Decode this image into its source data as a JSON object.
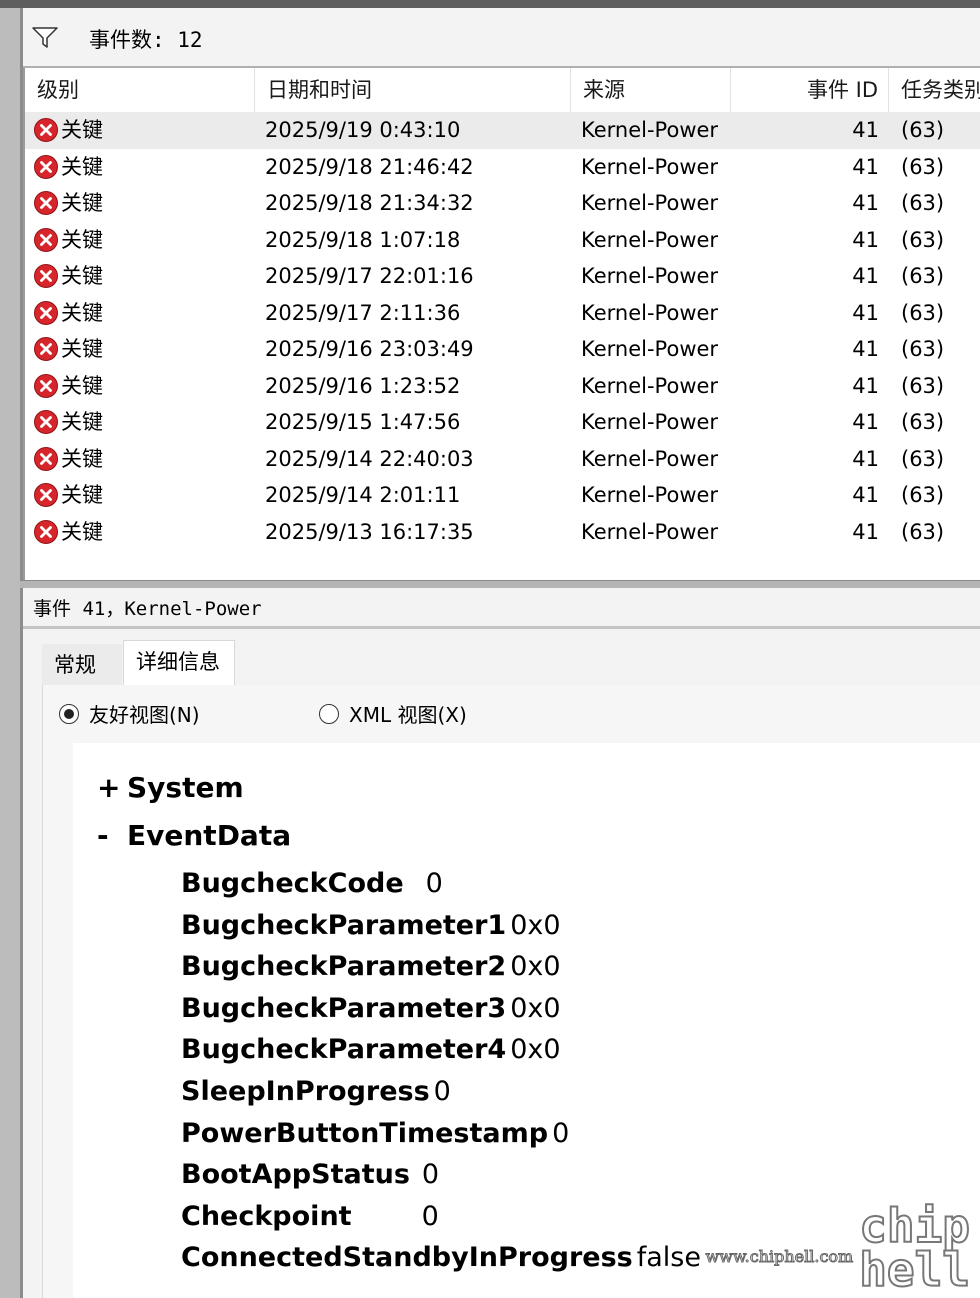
{
  "filter": {
    "label": "事件数: 12"
  },
  "columns": {
    "level": "级别",
    "datetime": "日期和时间",
    "source": "来源",
    "event_id": "事件 ID",
    "task": "任务类别"
  },
  "events": [
    {
      "level": "关键",
      "datetime": "2025/9/19 0:43:10",
      "source": "Kernel-Power",
      "event_id": "41",
      "task": "(63)"
    },
    {
      "level": "关键",
      "datetime": "2025/9/18 21:46:42",
      "source": "Kernel-Power",
      "event_id": "41",
      "task": "(63)"
    },
    {
      "level": "关键",
      "datetime": "2025/9/18 21:34:32",
      "source": "Kernel-Power",
      "event_id": "41",
      "task": "(63)"
    },
    {
      "level": "关键",
      "datetime": "2025/9/18 1:07:18",
      "source": "Kernel-Power",
      "event_id": "41",
      "task": "(63)"
    },
    {
      "level": "关键",
      "datetime": "2025/9/17 22:01:16",
      "source": "Kernel-Power",
      "event_id": "41",
      "task": "(63)"
    },
    {
      "level": "关键",
      "datetime": "2025/9/17 2:11:36",
      "source": "Kernel-Power",
      "event_id": "41",
      "task": "(63)"
    },
    {
      "level": "关键",
      "datetime": "2025/9/16 23:03:49",
      "source": "Kernel-Power",
      "event_id": "41",
      "task": "(63)"
    },
    {
      "level": "关键",
      "datetime": "2025/9/16 1:23:52",
      "source": "Kernel-Power",
      "event_id": "41",
      "task": "(63)"
    },
    {
      "level": "关键",
      "datetime": "2025/9/15 1:47:56",
      "source": "Kernel-Power",
      "event_id": "41",
      "task": "(63)"
    },
    {
      "level": "关键",
      "datetime": "2025/9/14 22:40:03",
      "source": "Kernel-Power",
      "event_id": "41",
      "task": "(63)"
    },
    {
      "level": "关键",
      "datetime": "2025/9/14 2:01:11",
      "source": "Kernel-Power",
      "event_id": "41",
      "task": "(63)"
    },
    {
      "level": "关键",
      "datetime": "2025/9/13 16:17:35",
      "source": "Kernel-Power",
      "event_id": "41",
      "task": "(63)"
    }
  ],
  "detail": {
    "title": "事件 41，Kernel-Power",
    "tabs": {
      "general": "常规",
      "details": "详细信息"
    },
    "views": {
      "friendly": "友好视图(N)",
      "xml": "XML 视图(X)"
    },
    "tree": {
      "system": {
        "toggle": "+",
        "label": "System"
      },
      "eventdata": {
        "toggle": "-",
        "label": "EventData",
        "fields": [
          {
            "key": "BugcheckCode",
            "value": "0"
          },
          {
            "key": "BugcheckParameter1",
            "value": "0x0"
          },
          {
            "key": "BugcheckParameter2",
            "value": "0x0"
          },
          {
            "key": "BugcheckParameter3",
            "value": "0x0"
          },
          {
            "key": "BugcheckParameter4",
            "value": "0x0"
          },
          {
            "key": "SleepInProgress",
            "value": "0"
          },
          {
            "key": "PowerButtonTimestamp",
            "value": "0"
          },
          {
            "key": "BootAppStatus",
            "value": "0"
          },
          {
            "key": "Checkpoint",
            "value": "0"
          },
          {
            "key": "ConnectedStandbyInProgress",
            "value": "false"
          }
        ]
      }
    }
  },
  "watermark": {
    "url": "www.chiphell.com",
    "logo_top": "chip",
    "logo_bottom": "hell"
  },
  "colors": {
    "critical": "#d6262c"
  }
}
